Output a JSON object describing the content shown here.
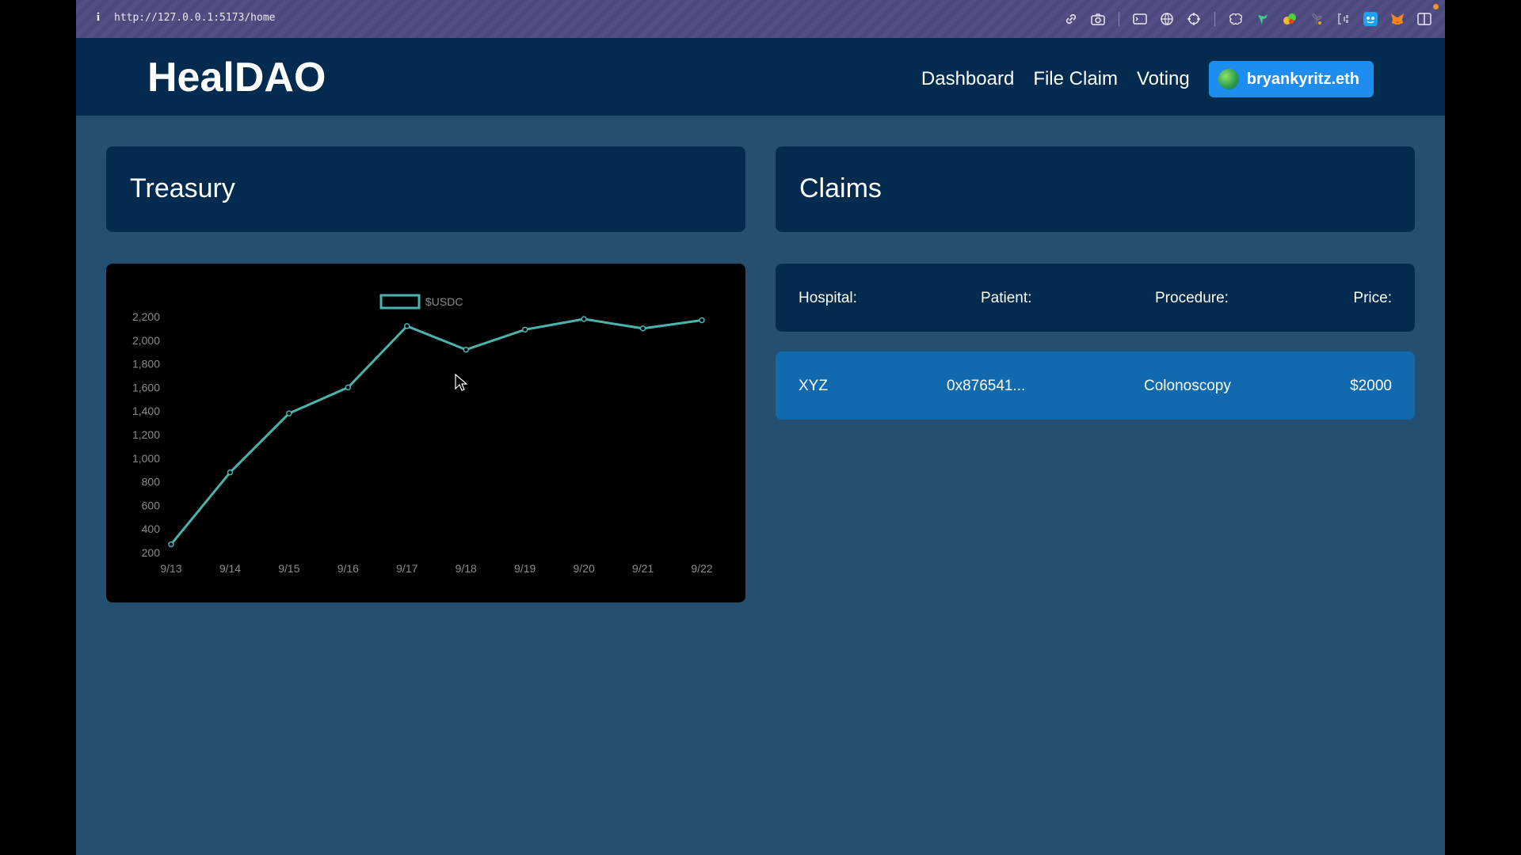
{
  "browser": {
    "url": "http://127.0.0.1:5173/home"
  },
  "app": {
    "logo": "HealDAO",
    "nav": {
      "dashboard": "Dashboard",
      "file_claim": "File Claim",
      "voting": "Voting"
    },
    "wallet": "bryankyritz.eth"
  },
  "treasury": {
    "title": "Treasury"
  },
  "claims": {
    "title": "Claims",
    "headers": {
      "hospital": "Hospital:",
      "patient": "Patient:",
      "procedure": "Procedure:",
      "price": "Price:"
    },
    "rows": [
      {
        "hospital": "XYZ",
        "patient": "0x876541...",
        "procedure": "Colonoscopy",
        "price": "$2000"
      }
    ]
  },
  "colors": {
    "accent": "#1e8df0",
    "line": "#4bb3ad",
    "header": "#022b4f",
    "page": "#254f71",
    "row": "#116aad"
  },
  "chart_data": {
    "type": "line",
    "title": "",
    "xlabel": "",
    "ylabel": "",
    "x": [
      "9/13",
      "9/14",
      "9/15",
      "9/16",
      "9/17",
      "9/18",
      "9/19",
      "9/20",
      "9/21",
      "9/22"
    ],
    "series": [
      {
        "name": "$USDC",
        "values": [
          270,
          880,
          1380,
          1600,
          2120,
          1920,
          2090,
          2180,
          2100,
          2170
        ]
      }
    ],
    "y_ticks": [
      "200",
      "400",
      "600",
      "800",
      "1,000",
      "1,200",
      "1,400",
      "1,600",
      "1,800",
      "2,000",
      "2,200"
    ],
    "ylim": [
      200,
      2200
    ],
    "legend": "top-center",
    "grid": false
  }
}
